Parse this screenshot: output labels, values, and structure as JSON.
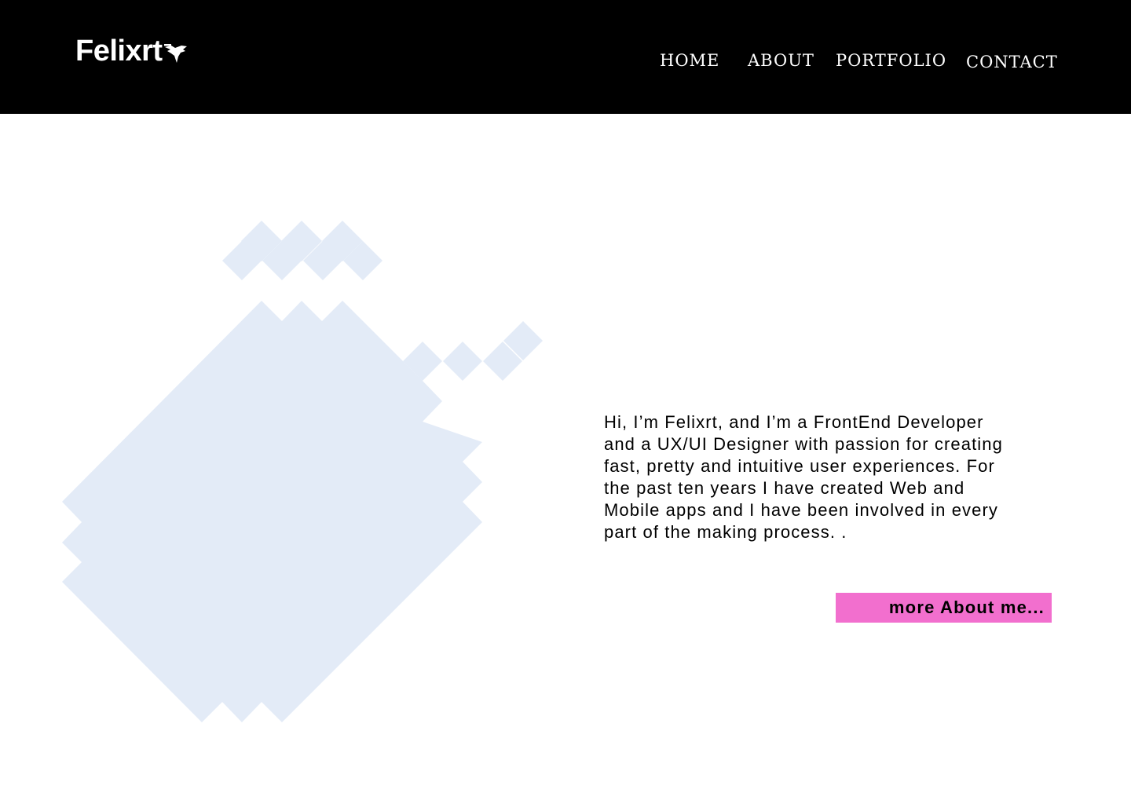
{
  "brand": {
    "name": "Felixrt",
    "mark_icon": "bird-icon"
  },
  "nav": {
    "items": [
      {
        "label": "HOME"
      },
      {
        "label": "ABOUT"
      },
      {
        "label": "PORTFOLIO"
      },
      {
        "label": "CONTACT"
      }
    ]
  },
  "hero": {
    "intro_text": "Hi, I’m Felixrt, and I’m a FrontEnd Developer\nand a UX/UI Designer with passion for creating\nfast, pretty and intuitive user experiences. For\nthe past ten years I have created Web and\nMobile apps and I have been involved in every\npart of the making process. .",
    "cta_label": "more About me...",
    "art_icon": "pixel-diamond-pattern"
  },
  "colors": {
    "header_bg": "#000000",
    "nav_text": "#ffffff",
    "page_bg": "#ffffff",
    "shape_fill": "#e3ebf7",
    "cta_bg": "#f26fce",
    "body_text": "#000000"
  }
}
